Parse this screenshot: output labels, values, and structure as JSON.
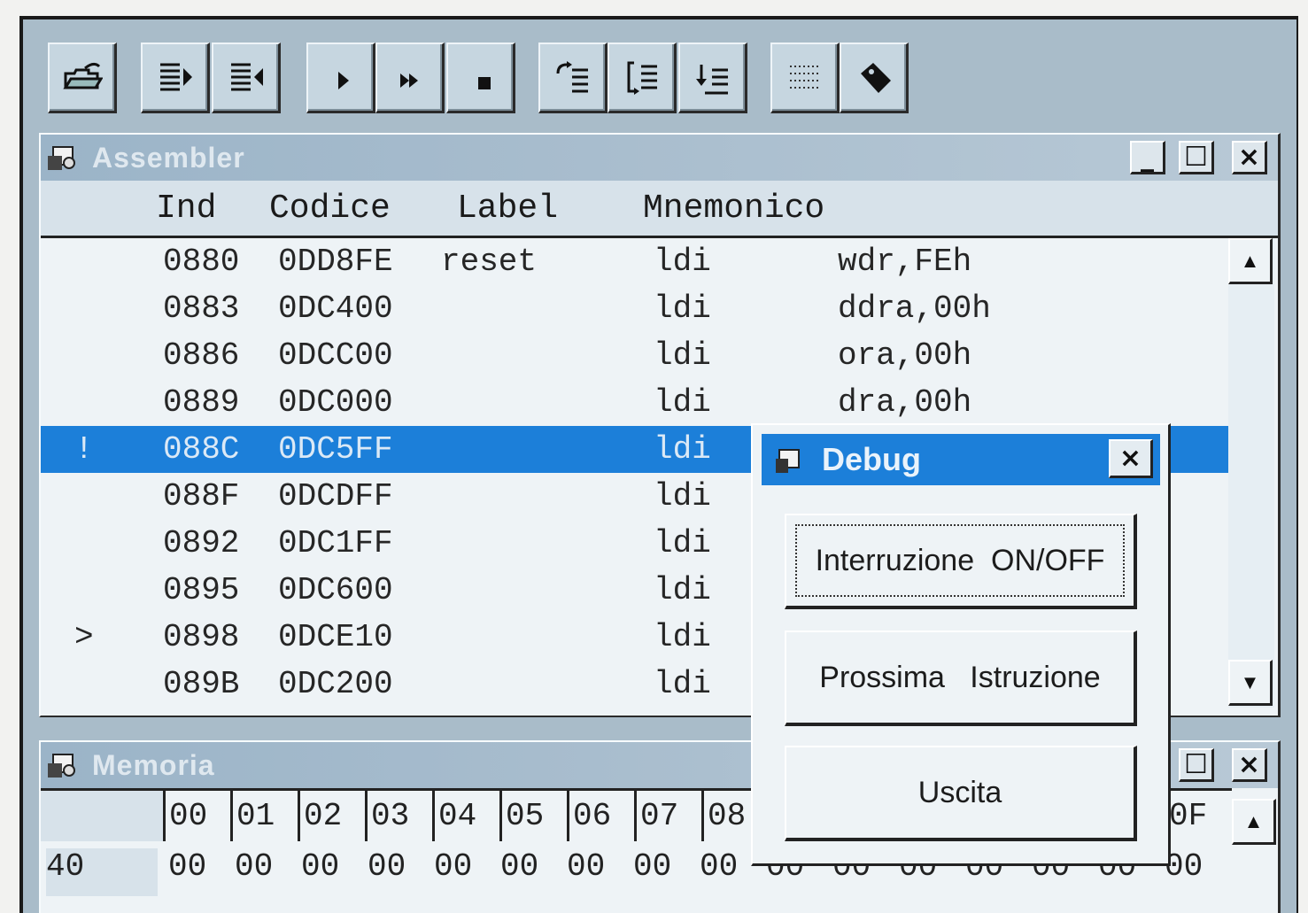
{
  "toolbar": {
    "buttons": [
      {
        "icon": "open-folder-icon"
      },
      {
        "icon": "step-into-icon"
      },
      {
        "icon": "step-out-icon"
      },
      {
        "icon": "play-icon"
      },
      {
        "icon": "fast-forward-icon"
      },
      {
        "icon": "stop-icon"
      },
      {
        "icon": "step-back-list-icon"
      },
      {
        "icon": "step-over-list-icon"
      },
      {
        "icon": "step-return-list-icon"
      },
      {
        "icon": "dotted-list-icon"
      },
      {
        "icon": "breakpoint-tag-icon"
      }
    ]
  },
  "assembler": {
    "title": "Assembler",
    "columns": {
      "ind": "Ind",
      "codice": "Codice",
      "label": "Label",
      "mnemonico": "Mnemonico"
    },
    "rows": [
      {
        "marker": "",
        "ind": "0880",
        "codice": "0DD8FE",
        "label": "reset",
        "op": "ldi",
        "args": "wdr,FEh"
      },
      {
        "marker": "",
        "ind": "0883",
        "codice": "0DC400",
        "label": "",
        "op": "ldi",
        "args": "ddra,00h"
      },
      {
        "marker": "",
        "ind": "0886",
        "codice": "0DCC00",
        "label": "",
        "op": "ldi",
        "args": "ora,00h"
      },
      {
        "marker": "",
        "ind": "0889",
        "codice": "0DC000",
        "label": "",
        "op": "ldi",
        "args": "dra,00h"
      },
      {
        "marker": "!",
        "ind": "088C",
        "codice": "0DC5FF",
        "label": "",
        "op": "ldi",
        "args": ""
      },
      {
        "marker": "",
        "ind": "088F",
        "codice": "0DCDFF",
        "label": "",
        "op": "ldi",
        "args": ""
      },
      {
        "marker": "",
        "ind": "0892",
        "codice": "0DC1FF",
        "label": "",
        "op": "ldi",
        "args": ""
      },
      {
        "marker": "",
        "ind": "0895",
        "codice": "0DC600",
        "label": "",
        "op": "ldi",
        "args": ""
      },
      {
        "marker": ">",
        "ind": "0898",
        "codice": "0DCE10",
        "label": "",
        "op": "ldi",
        "args": ""
      },
      {
        "marker": "",
        "ind": "089B",
        "codice": "0DC200",
        "label": "",
        "op": "ldi",
        "args": ""
      }
    ]
  },
  "memoria": {
    "title": "Memoria",
    "col_headers": [
      "00",
      "01",
      "02",
      "03",
      "04",
      "05",
      "06",
      "07",
      "08",
      "0F"
    ],
    "row_address": "40",
    "row_values": [
      "00",
      "00",
      "00",
      "00",
      "00",
      "00",
      "00",
      "00",
      "00",
      "00",
      "00",
      "00",
      "00",
      "00",
      "00",
      "00"
    ]
  },
  "debug": {
    "title": "Debug",
    "buttons": {
      "interrupt": "Interruzione  ON/OFF",
      "next": "Prossima   Istruzione",
      "exit": "Uscita"
    }
  },
  "colors": {
    "selection": "#1c7fd9",
    "frame": "#a9bcc9",
    "window_bg": "#eef3f6"
  }
}
